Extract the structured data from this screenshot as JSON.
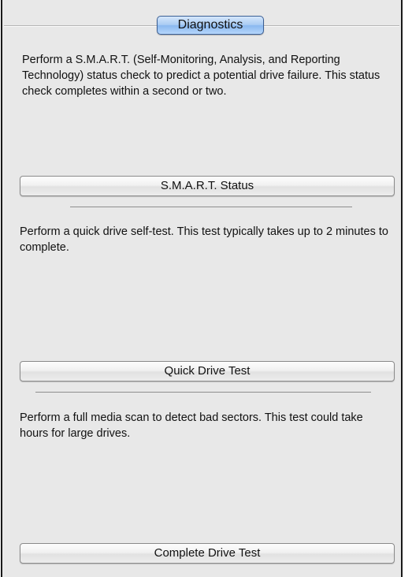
{
  "group": {
    "tab_label": "Diagnostics"
  },
  "sections": [
    {
      "description": "Perform a S.M.A.R.T. (Self-Monitoring, Analysis, and Reporting Technology) status check to predict a potential drive failure. This status check completes within a second or two.",
      "button_label": "S.M.A.R.T. Status"
    },
    {
      "description": "Perform a quick drive self-test. This test typically takes up to 2 minutes to complete.",
      "button_label": "Quick Drive Test"
    },
    {
      "description": "Perform a full media scan to detect bad sectors. This test could take hours for large drives.",
      "button_label": "Complete Drive Test"
    }
  ]
}
